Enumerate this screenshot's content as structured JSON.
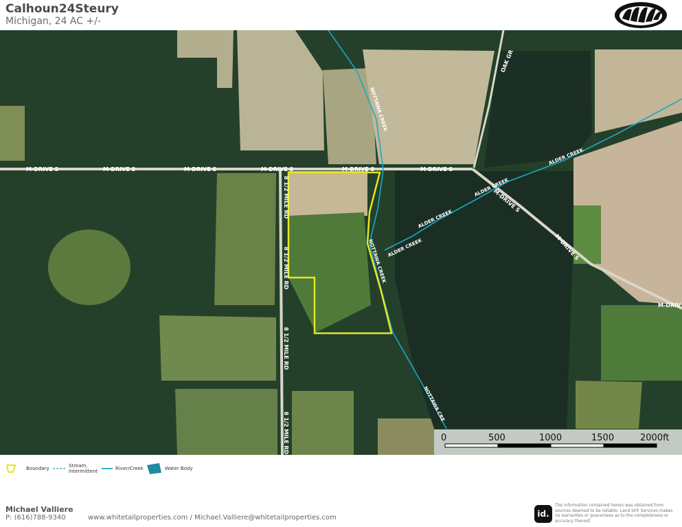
{
  "header": {
    "title": "Calhoun24Steury",
    "subtitle": "Michigan, 24 AC +/-",
    "logo_icon": "bear-paw-logo-icon"
  },
  "map": {
    "road_labels": {
      "m_drive_s": "M-DRIVE S",
      "half_mile_rd_a": "8 1/2 MILE RD",
      "half_mile_rd_b": "8 1/2 MILE RD",
      "half_mile_rd_c": "8 1/2 MILE RD",
      "half_mile_rd_d": "8 1/2 MILE RD",
      "oak_grove": "OAK GR",
      "m_drive_partial": "M-DRIV"
    },
    "creek_labels": {
      "nottawa_1": "NOTTAWA CREEK",
      "nottawa_2": "NOTTAWA CREEK",
      "nottawa_3": "NOTTAWA CRE",
      "alder_1": "ALDER CREEK",
      "alder_2": "ALDER CREEK",
      "alder_3": "ALDER CREEK",
      "alder_4": "ALDER CREEK"
    },
    "colors": {
      "boundary": "#e6e622",
      "river": "#19a9c9",
      "road": "#d9d6c8"
    }
  },
  "scale": {
    "ticks": [
      "0",
      "500",
      "1000",
      "1500",
      "2000ft"
    ]
  },
  "legend": {
    "items": [
      {
        "label": "Boundary",
        "icon": "boundary-icon"
      },
      {
        "label": "Stream, Intermittent",
        "icon": "stream-icon"
      },
      {
        "label": "River/Creek",
        "icon": "river-icon"
      },
      {
        "label": "Water Body",
        "icon": "water-body-icon"
      }
    ]
  },
  "footer": {
    "agent_name": "Michael Valliere",
    "agent_phone": "P: (616)788-9340",
    "contact": "www.whitetailproperties.com / Michael.Valliere@whitetailproperties.com",
    "badge": "id.",
    "disclaimer": "The information contained herein was obtained from sources deemed to be reliable. Land id® Services makes no warranties or guarantees as to the completeness or accuracy thereof."
  }
}
